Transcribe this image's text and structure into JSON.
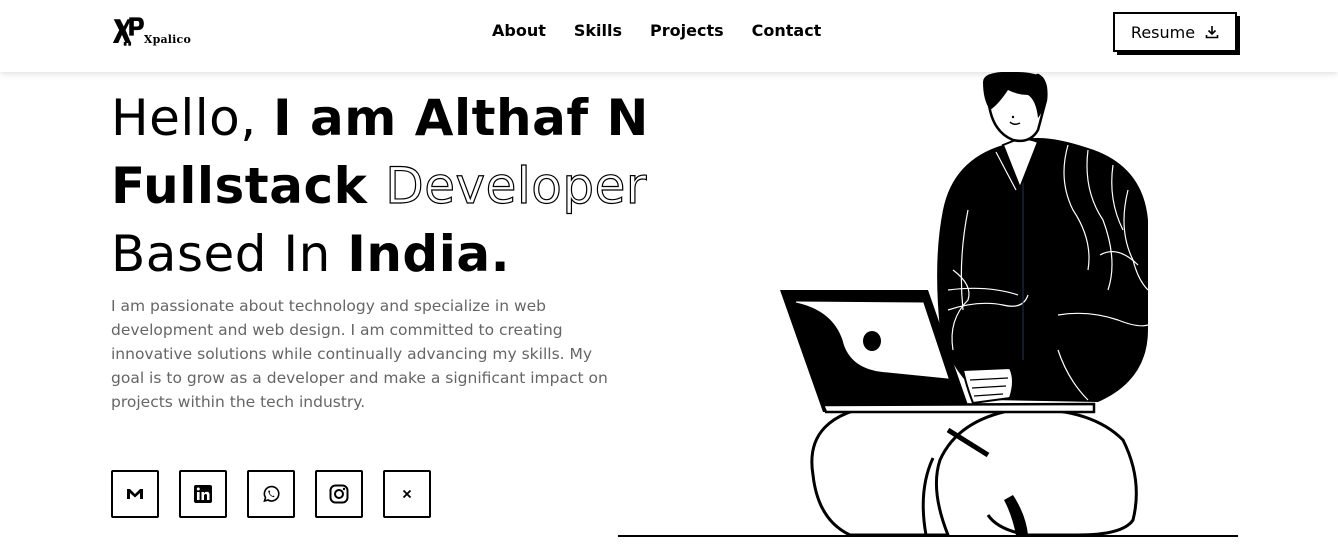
{
  "header": {
    "logo_text": "Xpalico",
    "nav": [
      {
        "label": "About"
      },
      {
        "label": "Skills"
      },
      {
        "label": "Projects"
      },
      {
        "label": "Contact"
      }
    ],
    "resume_label": "Resume"
  },
  "hero": {
    "line1_light": "Hello, ",
    "line1_bold": "I am Althaf N",
    "line2_bold": "Fullstack ",
    "line2_outline": "Developer",
    "line3_light": "Based In ",
    "line3_bold": "India.",
    "description": "I am passionate about technology and specialize in web development and web design. I am committed to creating innovative solutions while continually advancing my skills. My goal is to grow as a developer and make a significant impact on projects within the tech industry."
  },
  "socials": [
    {
      "icon": "gmail-icon"
    },
    {
      "icon": "linkedin-icon"
    },
    {
      "icon": "whatsapp-icon"
    },
    {
      "icon": "instagram-icon"
    },
    {
      "icon": "x-icon"
    }
  ],
  "colors": {
    "text": "#000000",
    "muted": "#666666",
    "background": "#ffffff"
  }
}
